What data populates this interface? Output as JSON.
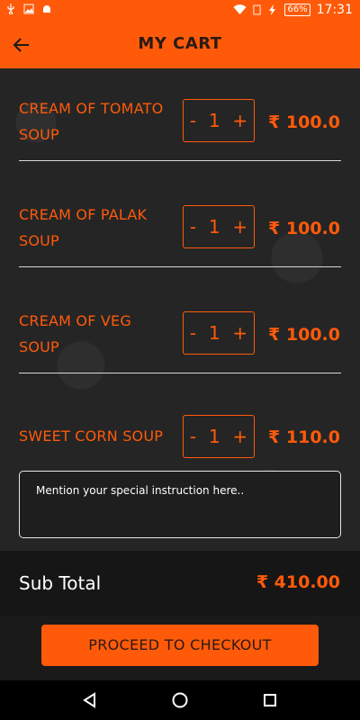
{
  "status_bar": {
    "battery": "66%",
    "time": "17:31"
  },
  "header": {
    "title": "MY CART"
  },
  "currency": "₹",
  "cart_items": [
    {
      "name_line1": "CREAM OF TOMATO",
      "name_line2": "SOUP",
      "quantity": "1",
      "price": "100.0"
    },
    {
      "name_line1": "CREAM OF PALAK",
      "name_line2": "SOUP",
      "quantity": "1",
      "price": "100.0"
    },
    {
      "name_line1": "CREAM OF VEG",
      "name_line2": "SOUP",
      "quantity": "1",
      "price": "100.0"
    },
    {
      "name_line1": "SWEET CORN SOUP",
      "name_line2": "",
      "quantity": "1",
      "price": "110.0"
    }
  ],
  "stepper": {
    "minus": "-",
    "plus": "+"
  },
  "instruction": {
    "placeholder": "Mention your special instruction here.."
  },
  "subtotal": {
    "label": "Sub Total",
    "amount": "410.00"
  },
  "checkout": {
    "label": "PROCEED TO CHECKOUT"
  },
  "colors": {
    "accent": "#ff5a0a",
    "background": "#252525",
    "text": "#ffffff"
  },
  "icons": [
    "usb-icon",
    "image-icon",
    "android-icon",
    "wifi-icon",
    "sim-icon",
    "charging-icon",
    "back-arrow-icon",
    "nav-back-icon",
    "nav-home-icon",
    "nav-recents-icon"
  ]
}
